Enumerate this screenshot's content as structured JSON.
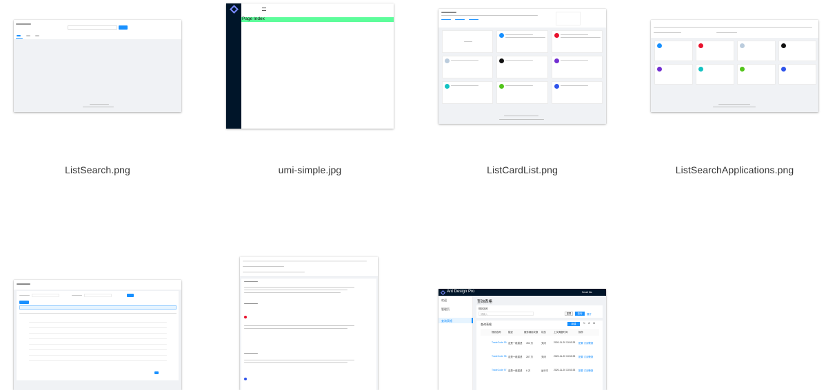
{
  "files": [
    {
      "caption": "ListSearch.png"
    },
    {
      "caption": "umi-simple.jpg"
    },
    {
      "caption": "ListCardList.png"
    },
    {
      "caption": "ListSearchApplications.png"
    },
    {
      "caption": ""
    },
    {
      "caption": ""
    },
    {
      "caption": ""
    }
  ],
  "umi": {
    "page_index": "Page Index"
  },
  "query_table": {
    "brand": "Ant Design Pro",
    "menu": [
      "欢迎",
      "管理页",
      "查询表格"
    ],
    "page_title": "查询表格",
    "rule_name_label": "规则名称",
    "rule_name_placeholder": "请输入",
    "reset_button": "重置",
    "query_button": "查询",
    "expand_link": "展开",
    "table_title": "查询表格",
    "new_button": "新建",
    "columns": [
      "规则名称",
      "描述",
      "服务调用次数",
      "状态",
      "上次调度时间",
      "操作"
    ],
    "rows": [
      {
        "name": "TradeCode 99",
        "desc": "这是一段描述",
        "calls": "494 万",
        "status": "关闭",
        "time": "2020-11-20 13:53:33",
        "ops": "配置 订阅警报"
      },
      {
        "name": "TradeCode 98",
        "desc": "这是一段描述",
        "calls": "287 万",
        "status": "关闭",
        "time": "2020-11-20 13:53:33",
        "ops": "配置 订阅警报"
      },
      {
        "name": "TradeCode 97",
        "desc": "这是一段描述",
        "calls": "6 万",
        "status": "运行中",
        "time": "2020-11-20 13:53:33",
        "ops": "配置 订阅警报"
      }
    ],
    "user_name": "Serati Ma"
  },
  "colors": {
    "accent": "#1890ff",
    "sider": "#001529",
    "green": "#5dfd9b",
    "bg": "#f0f2f5"
  }
}
